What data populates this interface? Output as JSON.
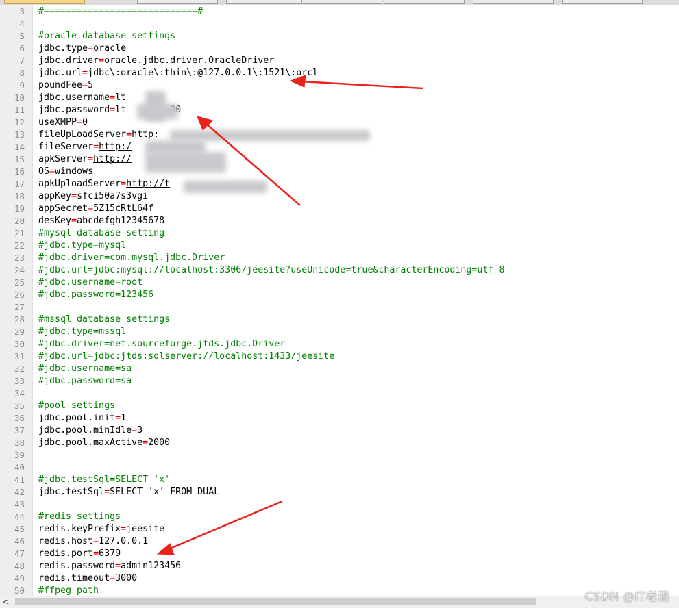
{
  "editor": {
    "lines": [
      {
        "n": "3",
        "parts": [
          {
            "t": "#============================#",
            "c": "comment"
          }
        ]
      },
      {
        "n": "4",
        "parts": []
      },
      {
        "n": "5",
        "parts": [
          {
            "t": "#oracle database settings",
            "c": "comment"
          }
        ]
      },
      {
        "n": "6",
        "parts": [
          {
            "t": "jdbc.type",
            "c": "key"
          },
          {
            "t": "=",
            "c": "eq"
          },
          {
            "t": "oracle",
            "c": "val"
          }
        ]
      },
      {
        "n": "7",
        "parts": [
          {
            "t": "jdbc.driver",
            "c": "key"
          },
          {
            "t": "=",
            "c": "eq"
          },
          {
            "t": "oracle.jdbc.driver.OracleDriver",
            "c": "val"
          }
        ]
      },
      {
        "n": "8",
        "parts": [
          {
            "t": "jdbc.url",
            "c": "key"
          },
          {
            "t": "=",
            "c": "eq"
          },
          {
            "t": "jdbc\\:oracle\\:thin\\:@127.0.0.1\\:1521\\:orcl",
            "c": "val"
          }
        ]
      },
      {
        "n": "9",
        "parts": [
          {
            "t": "poundFee",
            "c": "key"
          },
          {
            "t": "=",
            "c": "eq"
          },
          {
            "t": "5",
            "c": "val"
          }
        ]
      },
      {
        "n": "10",
        "parts": [
          {
            "t": "jdbc.username",
            "c": "key"
          },
          {
            "t": "=",
            "c": "eq"
          },
          {
            "t": "lt",
            "c": "val"
          }
        ]
      },
      {
        "n": "11",
        "parts": [
          {
            "t": "jdbc.password",
            "c": "key"
          },
          {
            "t": "=",
            "c": "eq"
          },
          {
            "t": "lt        00",
            "c": "val"
          }
        ]
      },
      {
        "n": "12",
        "parts": [
          {
            "t": "useXMPP",
            "c": "key"
          },
          {
            "t": "=",
            "c": "eq"
          },
          {
            "t": "0",
            "c": "val"
          }
        ]
      },
      {
        "n": "13",
        "parts": [
          {
            "t": "fileUpLoadServer",
            "c": "key"
          },
          {
            "t": "=",
            "c": "eq"
          },
          {
            "t": "http:",
            "c": "url"
          }
        ]
      },
      {
        "n": "14",
        "parts": [
          {
            "t": "fileServer",
            "c": "key"
          },
          {
            "t": "=",
            "c": "eq"
          },
          {
            "t": "http:/",
            "c": "url"
          }
        ]
      },
      {
        "n": "15",
        "parts": [
          {
            "t": "apkServer",
            "c": "key"
          },
          {
            "t": "=",
            "c": "eq"
          },
          {
            "t": "http://",
            "c": "url"
          }
        ]
      },
      {
        "n": "16",
        "parts": [
          {
            "t": "OS",
            "c": "key"
          },
          {
            "t": "=",
            "c": "eq"
          },
          {
            "t": "windows",
            "c": "val"
          }
        ]
      },
      {
        "n": "17",
        "parts": [
          {
            "t": "apkUploadServer",
            "c": "key"
          },
          {
            "t": "=",
            "c": "eq"
          },
          {
            "t": "http://t",
            "c": "url"
          }
        ]
      },
      {
        "n": "18",
        "parts": [
          {
            "t": "appKey",
            "c": "key"
          },
          {
            "t": "=",
            "c": "eq"
          },
          {
            "t": "sfci50a7s3vgi",
            "c": "val"
          }
        ]
      },
      {
        "n": "19",
        "parts": [
          {
            "t": "appSecret",
            "c": "key"
          },
          {
            "t": "=",
            "c": "eq"
          },
          {
            "t": "5Z15cRtL64f",
            "c": "val"
          }
        ]
      },
      {
        "n": "20",
        "parts": [
          {
            "t": "desKey",
            "c": "key"
          },
          {
            "t": "=",
            "c": "eq"
          },
          {
            "t": "abcdefgh12345678",
            "c": "val"
          }
        ]
      },
      {
        "n": "21",
        "parts": [
          {
            "t": "#mysql database setting",
            "c": "comment"
          }
        ]
      },
      {
        "n": "22",
        "parts": [
          {
            "t": "#jdbc.type=mysql",
            "c": "comment"
          }
        ]
      },
      {
        "n": "23",
        "parts": [
          {
            "t": "#jdbc.driver=com.mysql.jdbc.Driver",
            "c": "comment"
          }
        ]
      },
      {
        "n": "24",
        "parts": [
          {
            "t": "#jdbc.url=jdbc:mysql://localhost:3306/jeesite?useUnicode=true&characterEncoding=utf-8",
            "c": "comment"
          }
        ]
      },
      {
        "n": "25",
        "parts": [
          {
            "t": "#jdbc.username=root",
            "c": "comment"
          }
        ]
      },
      {
        "n": "26",
        "parts": [
          {
            "t": "#jdbc.password=123456",
            "c": "comment"
          }
        ]
      },
      {
        "n": "27",
        "parts": []
      },
      {
        "n": "28",
        "parts": [
          {
            "t": "#mssql database settings",
            "c": "comment"
          }
        ]
      },
      {
        "n": "29",
        "parts": [
          {
            "t": "#jdbc.type=mssql",
            "c": "comment"
          }
        ]
      },
      {
        "n": "30",
        "parts": [
          {
            "t": "#jdbc.driver=net.sourceforge.jtds.jdbc.Driver",
            "c": "comment"
          }
        ]
      },
      {
        "n": "31",
        "parts": [
          {
            "t": "#jdbc.url=jdbc:jtds:sqlserver://localhost:1433/jeesite",
            "c": "comment"
          }
        ]
      },
      {
        "n": "32",
        "parts": [
          {
            "t": "#jdbc.username=sa",
            "c": "comment"
          }
        ]
      },
      {
        "n": "33",
        "parts": [
          {
            "t": "#jdbc.password=sa",
            "c": "comment"
          }
        ]
      },
      {
        "n": "34",
        "parts": []
      },
      {
        "n": "35",
        "parts": [
          {
            "t": "#pool settings",
            "c": "comment"
          }
        ]
      },
      {
        "n": "36",
        "parts": [
          {
            "t": "jdbc.pool.init",
            "c": "key"
          },
          {
            "t": "=",
            "c": "eq"
          },
          {
            "t": "1",
            "c": "val"
          }
        ]
      },
      {
        "n": "37",
        "parts": [
          {
            "t": "jdbc.pool.minIdle",
            "c": "key"
          },
          {
            "t": "=",
            "c": "eq"
          },
          {
            "t": "3",
            "c": "val"
          }
        ]
      },
      {
        "n": "38",
        "parts": [
          {
            "t": "jdbc.pool.maxActive",
            "c": "key"
          },
          {
            "t": "=",
            "c": "eq"
          },
          {
            "t": "2000",
            "c": "val"
          }
        ]
      },
      {
        "n": "39",
        "parts": []
      },
      {
        "n": "40",
        "parts": []
      },
      {
        "n": "41",
        "parts": [
          {
            "t": "#jdbc.testSql=SELECT 'x'",
            "c": "comment"
          }
        ]
      },
      {
        "n": "42",
        "parts": [
          {
            "t": "jdbc.testSql",
            "c": "key"
          },
          {
            "t": "=",
            "c": "eq"
          },
          {
            "t": "SELECT 'x' FROM DUAL",
            "c": "val"
          }
        ]
      },
      {
        "n": "43",
        "parts": []
      },
      {
        "n": "44",
        "parts": [
          {
            "t": "#redis settings",
            "c": "comment"
          }
        ]
      },
      {
        "n": "45",
        "parts": [
          {
            "t": "redis.keyPrefix",
            "c": "key"
          },
          {
            "t": "=",
            "c": "eq"
          },
          {
            "t": "jeesite",
            "c": "val"
          }
        ]
      },
      {
        "n": "46",
        "parts": [
          {
            "t": "redis.host",
            "c": "key"
          },
          {
            "t": "=",
            "c": "eq"
          },
          {
            "t": "127.0.0.1",
            "c": "val"
          }
        ]
      },
      {
        "n": "47",
        "parts": [
          {
            "t": "redis.port",
            "c": "key"
          },
          {
            "t": "=",
            "c": "eq"
          },
          {
            "t": "6379",
            "c": "val"
          }
        ]
      },
      {
        "n": "48",
        "parts": [
          {
            "t": "redis.password",
            "c": "key"
          },
          {
            "t": "=",
            "c": "eq"
          },
          {
            "t": "admin123456",
            "c": "val"
          }
        ]
      },
      {
        "n": "49",
        "parts": [
          {
            "t": "redis.timeout",
            "c": "key"
          },
          {
            "t": "=",
            "c": "eq"
          },
          {
            "t": "3000",
            "c": "val"
          }
        ]
      },
      {
        "n": "50",
        "parts": [
          {
            "t": "#ffpeg path",
            "c": "comment"
          }
        ]
      }
    ]
  },
  "scrollbar": {
    "left_arrow": "<"
  },
  "watermark": "CSDN @IT老涵",
  "colors": {
    "comment": "#008000",
    "operator": "#d40000",
    "arrow": "#e8231a"
  }
}
